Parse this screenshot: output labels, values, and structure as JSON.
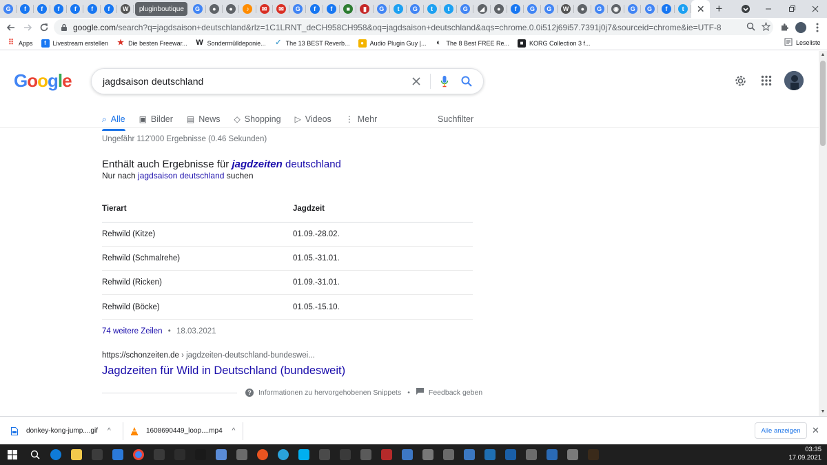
{
  "tabs": {
    "items": [
      {
        "icon": "google-icon",
        "glyph": "G",
        "color": "#4285f4"
      },
      {
        "icon": "facebook-icon",
        "glyph": "f",
        "color": "#1877f2"
      },
      {
        "icon": "facebook-icon",
        "glyph": "f",
        "color": "#1877f2"
      },
      {
        "icon": "facebook-icon",
        "glyph": "f",
        "color": "#1877f2"
      },
      {
        "icon": "facebook-icon",
        "glyph": "f",
        "color": "#1877f2"
      },
      {
        "icon": "facebook-icon",
        "glyph": "f",
        "color": "#1877f2"
      },
      {
        "icon": "facebook-icon",
        "glyph": "f",
        "color": "#1877f2"
      },
      {
        "icon": "wikipedia-icon",
        "glyph": "W",
        "color": "#555555"
      }
    ],
    "titled_tab": "pluginboutique",
    "items2": [
      {
        "icon": "google-icon",
        "glyph": "G",
        "color": "#4285f4"
      },
      {
        "icon": "site-icon",
        "glyph": "●",
        "color": "#5f6368"
      },
      {
        "icon": "site-icon",
        "glyph": "●",
        "color": "#5f6368"
      },
      {
        "icon": "audio-icon",
        "glyph": "♪",
        "color": "#ff8c00"
      },
      {
        "icon": "mail-icon",
        "glyph": "✉",
        "color": "#d93025"
      },
      {
        "icon": "mail-icon",
        "glyph": "✉",
        "color": "#d93025"
      },
      {
        "icon": "google-icon",
        "glyph": "G",
        "color": "#4285f4"
      },
      {
        "icon": "facebook-icon",
        "glyph": "f",
        "color": "#1877f2"
      },
      {
        "icon": "facebook-icon",
        "glyph": "f",
        "color": "#1877f2"
      },
      {
        "icon": "site-icon",
        "glyph": "■",
        "color": "#2e7d32"
      },
      {
        "icon": "site-icon",
        "glyph": "▮",
        "color": "#c62828"
      },
      {
        "icon": "google-icon",
        "glyph": "G",
        "color": "#4285f4"
      },
      {
        "icon": "twitter-icon",
        "glyph": "t",
        "color": "#1da1f2"
      },
      {
        "icon": "google-icon",
        "glyph": "G",
        "color": "#4285f4"
      },
      {
        "icon": "twitter-icon",
        "glyph": "t",
        "color": "#1da1f2"
      },
      {
        "icon": "twitter-icon",
        "glyph": "t",
        "color": "#1da1f2"
      },
      {
        "icon": "google-icon",
        "glyph": "G",
        "color": "#4285f4"
      },
      {
        "icon": "site-icon",
        "glyph": "◢",
        "color": "#5f6368"
      },
      {
        "icon": "site-icon",
        "glyph": "●",
        "color": "#5f6368"
      },
      {
        "icon": "facebook-icon",
        "glyph": "f",
        "color": "#1877f2"
      },
      {
        "icon": "google-icon",
        "glyph": "G",
        "color": "#4285f4"
      },
      {
        "icon": "google-icon",
        "glyph": "G",
        "color": "#4285f4"
      },
      {
        "icon": "wikipedia-icon",
        "glyph": "W",
        "color": "#555555"
      },
      {
        "icon": "site-icon",
        "glyph": "●",
        "color": "#5f6368"
      },
      {
        "icon": "google-icon",
        "glyph": "G",
        "color": "#4285f4"
      },
      {
        "icon": "chrome-icon",
        "glyph": "◉",
        "color": "#5f6368"
      },
      {
        "icon": "google-icon",
        "glyph": "G",
        "color": "#4285f4"
      },
      {
        "icon": "google-icon",
        "glyph": "G",
        "color": "#4285f4"
      },
      {
        "icon": "facebook-icon",
        "glyph": "f",
        "color": "#1877f2"
      },
      {
        "icon": "twitter-icon",
        "glyph": "t",
        "color": "#1da1f2"
      }
    ],
    "active_close": "✕",
    "new_tab": "+"
  },
  "toolbar": {
    "url_host": "google.com",
    "url_rest": "/search?q=jagdsaison+deutschland&rlz=1C1LRNT_deCH958CH958&oq=jagdsaison+deutschland&aqs=chrome.0.0i512j69i57.7391j0j7&sourceid=chrome&ie=UTF-8"
  },
  "bookmarks": {
    "items": [
      {
        "label": "Apps",
        "icon": "apps-grid-icon",
        "glyph": "⠿",
        "color": "#ea4335"
      },
      {
        "label": "Livestream erstellen",
        "icon": "facebook-icon",
        "glyph": "f",
        "color": "#1877f2"
      },
      {
        "label": "Die besten Freewar...",
        "icon": "star-icon",
        "glyph": "★",
        "color": "#d93025"
      },
      {
        "label": "Sondermülldeponie...",
        "icon": "w-icon",
        "glyph": "W",
        "color": "#202124"
      },
      {
        "label": "The 13 BEST Reverb...",
        "icon": "reverb-icon",
        "glyph": "✓",
        "color": "#4fa3d1"
      },
      {
        "label": "Audio Plugin Guy |...",
        "icon": "audio-plugin-icon",
        "glyph": "●",
        "color": "#f4b400"
      },
      {
        "label": "The 8 Best FREE Re...",
        "icon": "moon-icon",
        "glyph": "◐",
        "color": "#202124"
      },
      {
        "label": "KORG Collection 3 f...",
        "icon": "korg-icon",
        "glyph": "■",
        "color": "#202124"
      }
    ],
    "reading_list": "Leseliste"
  },
  "google": {
    "logo": [
      "G",
      "o",
      "o",
      "g",
      "l",
      "e"
    ],
    "query": "jagdsaison deutschland",
    "nav": [
      {
        "label": "Alle",
        "icon": "search-icon",
        "glyph": "⌕",
        "active": true
      },
      {
        "label": "Bilder",
        "icon": "images-icon",
        "glyph": "▣",
        "active": false
      },
      {
        "label": "News",
        "icon": "news-icon",
        "glyph": "▤",
        "active": false
      },
      {
        "label": "Shopping",
        "icon": "tag-icon",
        "glyph": "◇",
        "active": false
      },
      {
        "label": "Videos",
        "icon": "video-icon",
        "glyph": "▷",
        "active": false
      },
      {
        "label": "Mehr",
        "icon": "more-vert-icon",
        "glyph": "⋮",
        "active": false
      }
    ],
    "suchfilter": "Suchfilter",
    "stats": "Ungefähr 112'000 Ergebnisse (0.46 Sekunden)",
    "spell": {
      "prefix": "Enthält auch Ergebnisse für ",
      "corrected_bold": "jagdzeiten",
      "corrected_rest": " deutschland",
      "only_prefix": "Nur nach ",
      "only_link": "jagdsaison deutschland",
      "only_suffix": " suchen"
    },
    "table": {
      "headers": [
        "Tierart",
        "Jagdzeit"
      ],
      "rows": [
        [
          "Rehwild (Kitze)",
          "01.09.-28.02."
        ],
        [
          "Rehwild (Schmalrehe)",
          "01.05.-31.01."
        ],
        [
          "Rehwild (Ricken)",
          "01.09.-31.01."
        ],
        [
          "Rehwild (Böcke)",
          "01.05.-15.10."
        ]
      ]
    },
    "more_rows": "74 weitere Zeilen",
    "more_date": "18.03.2021",
    "bullet": "•",
    "result": {
      "domain": "https://schonzeiten.de",
      "path": " › jagdzeiten-deutschland-bundeswei...",
      "title": "Jagdzeiten für Wild in Deutschland (bundesweit)"
    },
    "snippet_info": "Informationen zu hervorgehobenen Snippets",
    "feedback": "Feedback geben"
  },
  "downloads": {
    "items": [
      {
        "name": "donkey-kong-jump....gif",
        "icon": "file-icon"
      },
      {
        "name": "1608690449_loop....mp4",
        "icon": "vlc-icon"
      }
    ],
    "show_all": "Alle anzeigen"
  },
  "taskbar": {
    "apps": [
      {
        "icon": "search-icon",
        "color": "#1f1f1f"
      },
      {
        "icon": "edge-icon",
        "color": "#0f7bd8"
      },
      {
        "icon": "explorer-icon",
        "color": "#f2c94c"
      },
      {
        "icon": "store-icon",
        "color": "#3c3c3c"
      },
      {
        "icon": "mail-icon",
        "color": "#2b79d9"
      },
      {
        "icon": "chrome-icon",
        "color": "#4285f4"
      },
      {
        "icon": "app-icon",
        "color": "#3a3a3a"
      },
      {
        "icon": "app-icon",
        "color": "#2d2d2d"
      },
      {
        "icon": "ableton-live-icon",
        "color": "#1a1a1a"
      },
      {
        "icon": "app-icon",
        "color": "#5a8bd6"
      },
      {
        "icon": "app-icon",
        "color": "#6a6a6a"
      },
      {
        "icon": "ubuntu-icon",
        "color": "#e95420"
      },
      {
        "icon": "telegram-icon",
        "color": "#2aa3db"
      },
      {
        "icon": "skype-icon",
        "color": "#00aff0"
      },
      {
        "icon": "app-icon",
        "color": "#4a4a4a"
      },
      {
        "icon": "kali-icon",
        "color": "#3a3a3a"
      },
      {
        "icon": "app-icon",
        "color": "#5a5a5a"
      },
      {
        "icon": "voicemeeter-icon",
        "color": "#b52a2a"
      },
      {
        "icon": "app-icon",
        "color": "#3d77c4"
      },
      {
        "icon": "app-icon",
        "color": "#777777"
      },
      {
        "icon": "app-icon",
        "color": "#6a6a6a"
      },
      {
        "icon": "virtualbox-icon",
        "color": "#3b78c2"
      },
      {
        "icon": "app-icon",
        "color": "#1f6fb3"
      },
      {
        "icon": "app-icon",
        "color": "#1a5fa8"
      },
      {
        "icon": "app-icon",
        "color": "#6b6b6b"
      },
      {
        "icon": "app-icon",
        "color": "#2a6ab5"
      },
      {
        "icon": "app-icon",
        "color": "#7a7a7a"
      },
      {
        "icon": "terminal-icon",
        "color": "#3a2a1a"
      }
    ],
    "time": "03:35",
    "date": "17.09.2021"
  }
}
